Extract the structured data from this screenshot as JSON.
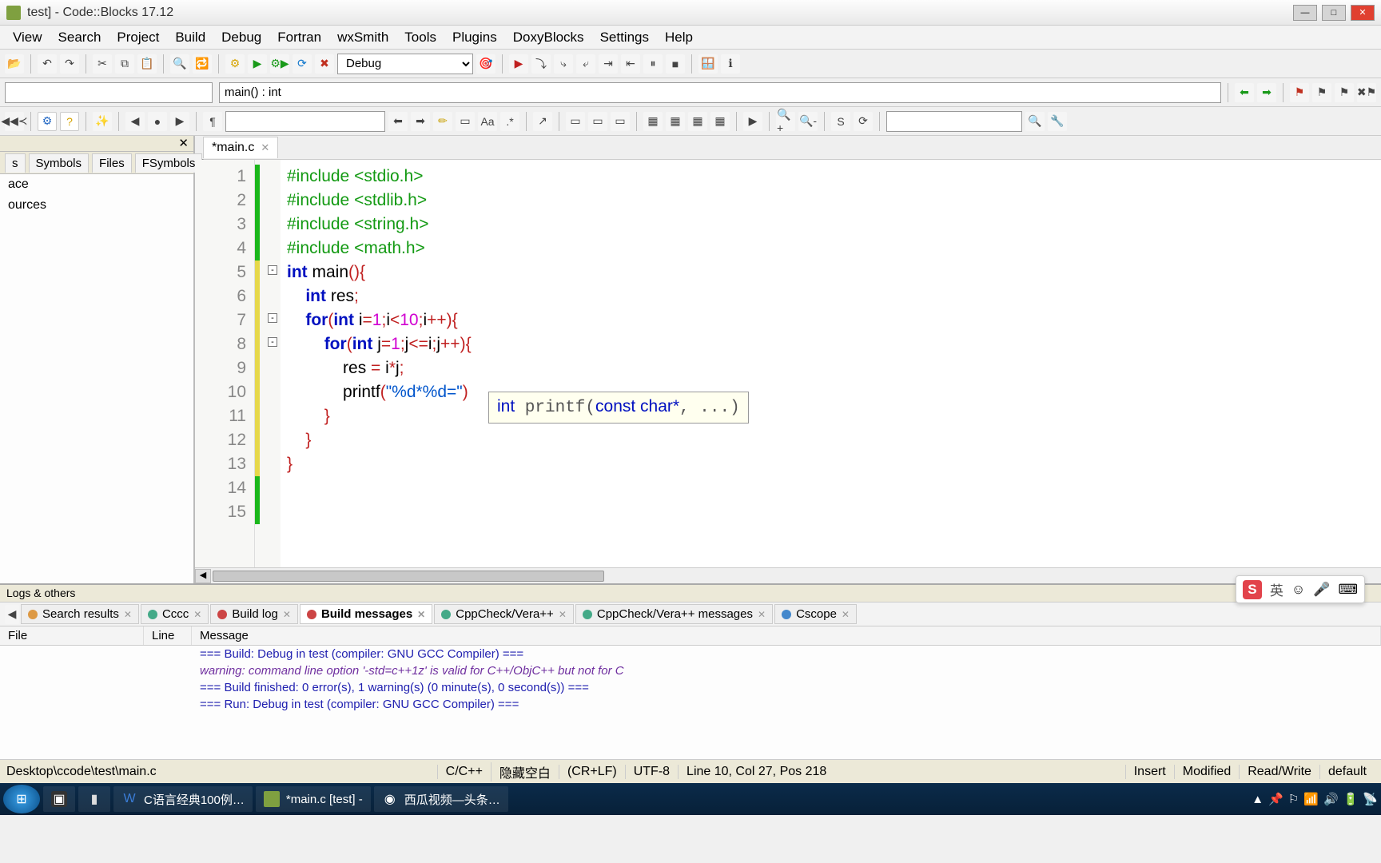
{
  "title": "test] - Code::Blocks 17.12",
  "menus": [
    "View",
    "Search",
    "Project",
    "Build",
    "Debug",
    "Fortran",
    "wxSmith",
    "Tools",
    "Plugins",
    "DoxyBlocks",
    "Settings",
    "Help"
  ],
  "build_config": "Debug",
  "scope_dropdown": "main() : int",
  "sidebar": {
    "tabs": [
      "s",
      "Symbols",
      "Files",
      "FSymbols"
    ],
    "items": [
      "ace",
      "ources"
    ]
  },
  "tab": {
    "name": "*main.c"
  },
  "code": {
    "lines": 15,
    "tooltip": "int printf(const char*, ...)",
    "src": [
      {
        "n": 1,
        "tokens": [
          [
            "pp",
            "#include "
          ],
          [
            "pp",
            "<stdio.h>"
          ]
        ]
      },
      {
        "n": 2,
        "tokens": [
          [
            "pp",
            "#include "
          ],
          [
            "pp",
            "<stdlib.h>"
          ]
        ]
      },
      {
        "n": 3,
        "tokens": [
          [
            "pp",
            "#include "
          ],
          [
            "pp",
            "<string.h>"
          ]
        ]
      },
      {
        "n": 4,
        "tokens": [
          [
            "pp",
            "#include "
          ],
          [
            "pp",
            "<math.h>"
          ]
        ]
      },
      {
        "n": 5,
        "tokens": [
          [
            "kw",
            "int "
          ],
          [
            "ident",
            "main"
          ],
          [
            "punc",
            "()"
          ],
          [
            "punc",
            "{"
          ]
        ]
      },
      {
        "n": 6,
        "indent": 1,
        "tokens": [
          [
            "kw",
            "int "
          ],
          [
            "ident",
            "res"
          ],
          [
            "punc",
            ";"
          ]
        ]
      },
      {
        "n": 7,
        "indent": 1,
        "tokens": [
          [
            "kw",
            "for"
          ],
          [
            "punc",
            "("
          ],
          [
            "kw",
            "int "
          ],
          [
            "ident",
            "i"
          ],
          [
            "op",
            "="
          ],
          [
            "num",
            "1"
          ],
          [
            "punc",
            ";"
          ],
          [
            "ident",
            "i"
          ],
          [
            "op",
            "<"
          ],
          [
            "num",
            "10"
          ],
          [
            "punc",
            ";"
          ],
          [
            "ident",
            "i"
          ],
          [
            "op",
            "++"
          ],
          [
            "punc",
            ")"
          ],
          [
            "punc",
            "{"
          ]
        ]
      },
      {
        "n": 8,
        "indent": 2,
        "tokens": [
          [
            "kw",
            "for"
          ],
          [
            "punc",
            "("
          ],
          [
            "kw",
            "int "
          ],
          [
            "ident",
            "j"
          ],
          [
            "op",
            "="
          ],
          [
            "num",
            "1"
          ],
          [
            "punc",
            ";"
          ],
          [
            "ident",
            "j"
          ],
          [
            "op",
            "<="
          ],
          [
            "ident",
            "i"
          ],
          [
            "punc",
            ";"
          ],
          [
            "ident",
            "j"
          ],
          [
            "op",
            "++"
          ],
          [
            "punc",
            ")"
          ],
          [
            "punc",
            "{"
          ]
        ]
      },
      {
        "n": 9,
        "indent": 3,
        "tokens": [
          [
            "ident",
            "res "
          ],
          [
            "op",
            "= "
          ],
          [
            "ident",
            "i"
          ],
          [
            "op",
            "*"
          ],
          [
            "ident",
            "j"
          ],
          [
            "punc",
            ";"
          ]
        ]
      },
      {
        "n": 10,
        "indent": 3,
        "tokens": [
          [
            "ident",
            "printf"
          ],
          [
            "punc",
            "("
          ],
          [
            "str",
            "\"%d*%d=\""
          ],
          [
            "punc",
            ")"
          ]
        ]
      },
      {
        "n": 11,
        "indent": 2,
        "tokens": [
          [
            "punc",
            "}"
          ]
        ]
      },
      {
        "n": 12,
        "indent": 1,
        "tokens": [
          [
            "punc",
            "}"
          ]
        ]
      },
      {
        "n": 13,
        "indent": 0,
        "tokens": [
          [
            "punc",
            "}"
          ]
        ]
      },
      {
        "n": 14,
        "indent": 0,
        "tokens": []
      },
      {
        "n": 15,
        "indent": 0,
        "tokens": []
      }
    ]
  },
  "logs": {
    "header": "Logs & others",
    "tabs": [
      "Search results",
      "Cccc",
      "Build log",
      "Build messages",
      "CppCheck/Vera++",
      "CppCheck/Vera++ messages",
      "Cscope"
    ],
    "active_tab": 3,
    "columns": [
      "File",
      "Line",
      "Message"
    ],
    "rows": [
      {
        "cls": "log-blue",
        "text": "=== Build: Debug in test (compiler: GNU GCC Compiler) ==="
      },
      {
        "cls": "log-purple",
        "text": "warning: command line option '-std=c++1z' is valid for C++/ObjC++ but not for C"
      },
      {
        "cls": "log-blue",
        "text": "=== Build finished: 0 error(s), 1 warning(s) (0 minute(s), 0 second(s)) ==="
      },
      {
        "cls": "log-blue",
        "text": "=== Run: Debug in test (compiler: GNU GCC Compiler) ==="
      }
    ]
  },
  "statusbar": {
    "path": "Desktop\\ccode\\test\\main.c",
    "lang": "C/C++",
    "hint": "隐藏空白",
    "eol": "(CR+LF)",
    "enc": "UTF-8",
    "pos": "Line 10, Col 27, Pos 218",
    "ins": "Insert",
    "mod": "Modified",
    "rw": "Read/Write",
    "prof": "default"
  },
  "taskbar": {
    "items": [
      "",
      "",
      "",
      "C语言经典100例…",
      "*main.c [test] -",
      "西瓜视频—头条…"
    ]
  },
  "ime": {
    "s": "S",
    "lang": "英"
  }
}
